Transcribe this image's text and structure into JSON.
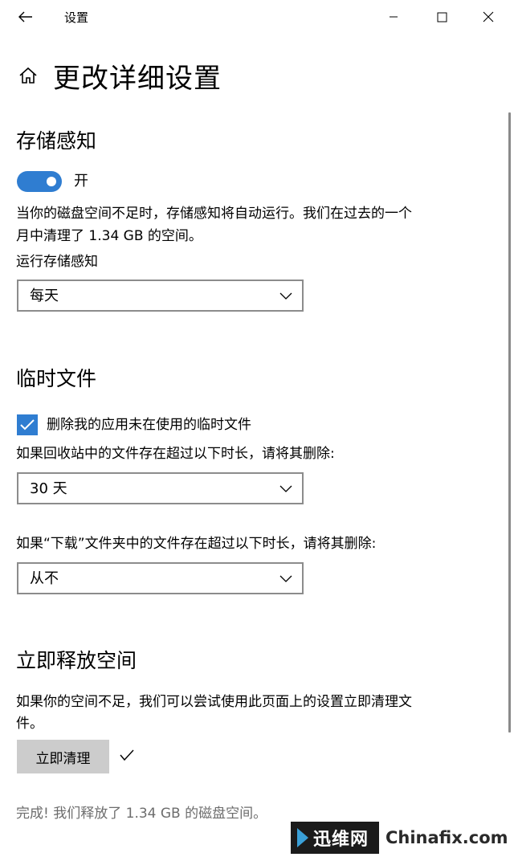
{
  "window": {
    "title": "设置",
    "back_icon": "arrow-left-icon",
    "controls": [
      "minimize-icon",
      "maximize-icon",
      "close-icon"
    ]
  },
  "header": {
    "home_icon": "home-icon",
    "title": "更改详细设置"
  },
  "storage_sense": {
    "title": "存储感知",
    "toggle_state": "on",
    "toggle_label": "开",
    "description_line1": "当你的磁盘空间不足时，存储感知将自动运行。我们在过去的一个",
    "description_line2": "月中清理了 1.34 GB 的空间。",
    "run_label": "运行存储感知",
    "run_value": "每天"
  },
  "temp_files": {
    "title": "临时文件",
    "checkbox_checked": true,
    "checkbox_label": "删除我的应用未在使用的临时文件",
    "recycle_label": "如果回收站中的文件存在超过以下时长，请将其删除:",
    "recycle_value": "30 天",
    "downloads_label": "如果“下载”文件夹中的文件存在超过以下时长，请将其删除:",
    "downloads_value": "从不"
  },
  "free_space": {
    "title": "立即释放空间",
    "description_line1": "如果你的空间不足，我们可以尝试使用此页面上的设置立即清理文",
    "description_line2": "件。",
    "button_label": "立即清理",
    "done_icon": "checkmark-icon",
    "result": "完成! 我们释放了 1.34 GB 的磁盘空间。"
  },
  "watermark": {
    "cn": "迅维网",
    "en": "Chinafix.com"
  },
  "colors": {
    "accent": "#2f7dd1",
    "button_bg": "#cccccc",
    "muted_text": "#6d6d6d"
  }
}
